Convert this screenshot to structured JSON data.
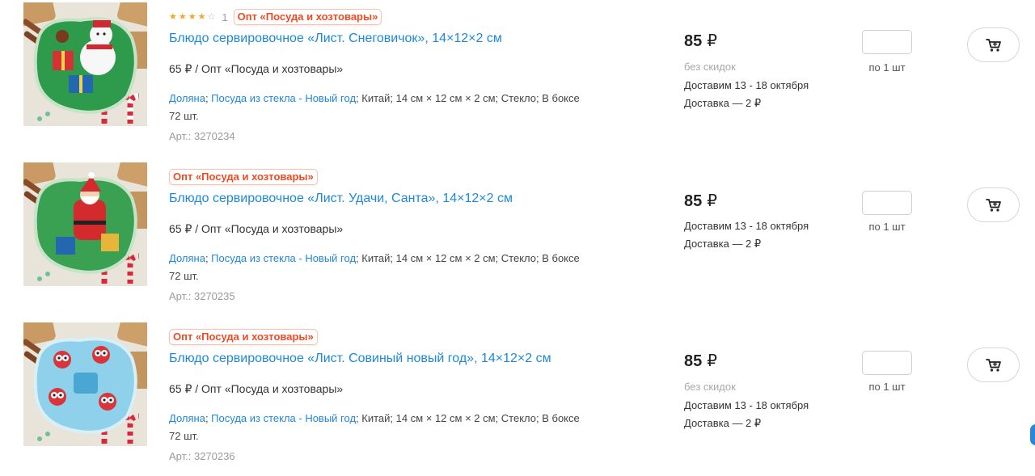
{
  "colors": {
    "accent_blue": "#1e88d8",
    "badge_red": "#f04a23",
    "star_filled": "#f5a623",
    "muted_gray": "#9b9b9b"
  },
  "products": [
    {
      "rating": 4,
      "rating_max": 5,
      "rating_count": "1",
      "seller_badge": "Опт «Посуда и хозтовары»",
      "title": "Блюдо сервировочное «Лист. Снеговичок», 14×12×2 см",
      "unit_price": "65 ₽ / Опт «Посуда и хозтовары»",
      "brand": "Доляна",
      "category": "Посуда из стекла - Новый год",
      "specs": "; Китай; 14 см × 12 см × 2 см; Стекло; В боксе 72 шт.",
      "article": "Арт.: 3270234",
      "price": "85",
      "currency": "₽",
      "no_discount": "без скидок",
      "delivery_dates": "Доставим 13 - 18 октября",
      "delivery_cost": "Доставка — 2 ₽",
      "quantity_value": "",
      "per_unit": "по 1 шт",
      "image_icon": "snowman-plate-image",
      "cart_icon": "cart-icon"
    },
    {
      "seller_badge": "Опт «Посуда и хозтовары»",
      "title": "Блюдо сервировочное «Лист. Удачи, Санта», 14×12×2 см",
      "unit_price": "65 ₽ / Опт «Посуда и хозтовары»",
      "brand": "Доляна",
      "category": "Посуда из стекла - Новый год",
      "specs": "; Китай; 14 см × 12 см × 2 см; Стекло; В боксе 72 шт.",
      "article": "Арт.: 3270235",
      "price": "85",
      "currency": "₽",
      "delivery_dates": "Доставим 13 - 18 октября",
      "delivery_cost": "Доставка — 2 ₽",
      "quantity_value": "",
      "per_unit": "по 1 шт",
      "image_icon": "santa-plate-image",
      "cart_icon": "cart-icon"
    },
    {
      "seller_badge": "Опт «Посуда и хозтовары»",
      "title": "Блюдо сервировочное «Лист. Совиный новый год», 14×12×2 см",
      "unit_price": "65 ₽ / Опт «Посуда и хозтовары»",
      "brand": "Доляна",
      "category": "Посуда из стекла - Новый год",
      "specs": "; Китай; 14 см × 12 см × 2 см; Стекло; В боксе 72 шт.",
      "article": "Арт.: 3270236",
      "price": "85",
      "currency": "₽",
      "no_discount": "без скидок",
      "delivery_dates": "Доставим 13 - 18 октября",
      "delivery_cost": "Доставка — 2 ₽",
      "quantity_value": "",
      "per_unit": "по 1 шт",
      "image_icon": "owl-plate-image",
      "cart_icon": "cart-icon"
    }
  ]
}
